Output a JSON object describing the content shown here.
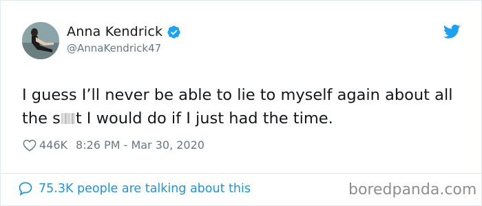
{
  "tweet": {
    "display_name": "Anna Kendrick",
    "handle": "@AnnaKendrick47",
    "text_before": "I guess I’ll never be able to lie to myself again about all the s",
    "text_after": "t I would do if I just had the time.",
    "likes": "446K",
    "timestamp": "8:26 PM - Mar 30, 2020",
    "talking": "75.3K people are talking about this"
  },
  "icons": {
    "verified": "verified-badge-icon",
    "bird": "twitter-bird-icon",
    "heart": "heart-icon",
    "bubble": "speech-bubble-icon"
  },
  "colors": {
    "twitter_blue": "#1da1f2",
    "link_blue": "#1b95e0",
    "muted": "#657786"
  },
  "watermark": "boredpanda.com"
}
